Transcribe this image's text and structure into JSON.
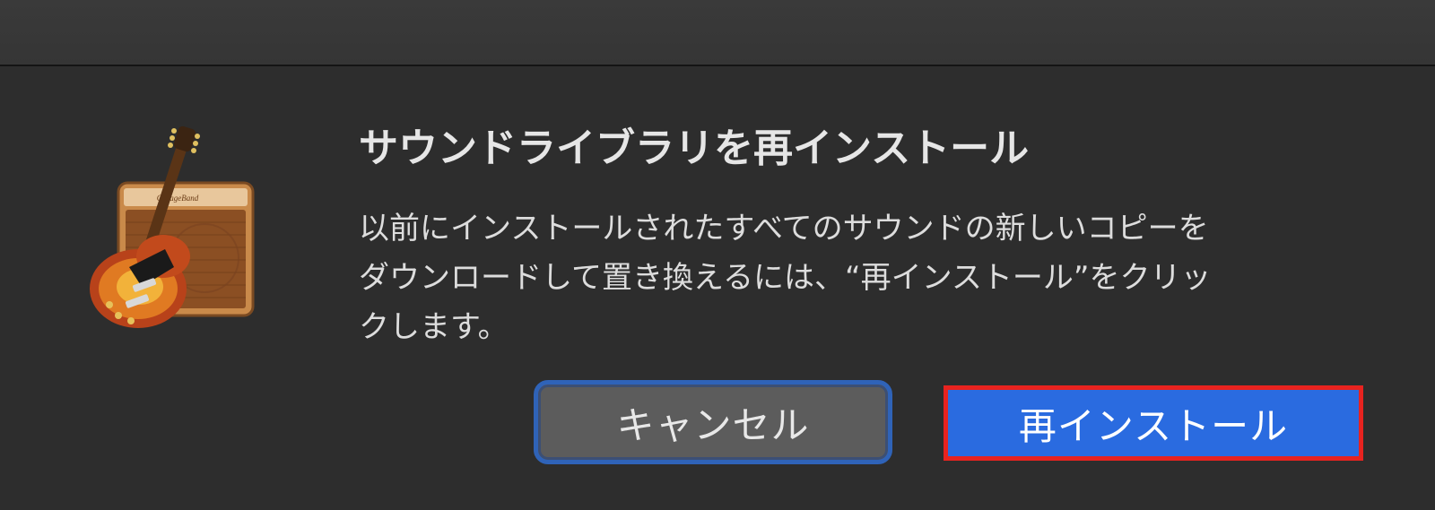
{
  "dialog": {
    "title": "サウンドライブラリを再インストール",
    "message_lines": [
      "以前にインストールされたすべてのサウンドの新しいコピーを",
      "ダウンロードして置き換えるには、“再インストール”をクリッ",
      "クします。"
    ],
    "icon": "garageband-guitar-amp-icon",
    "amp_logo_text": "GarageBand"
  },
  "buttons": {
    "cancel_label": "キャンセル",
    "reinstall_label": "再インストール"
  },
  "colors": {
    "background": "#2d2d2d",
    "titlebar": "#383838",
    "primary_button": "#2a6be0",
    "cancel_button": "#5c5c5c",
    "focus_ring": "#2f63b8",
    "highlight_border": "#e8231f"
  }
}
